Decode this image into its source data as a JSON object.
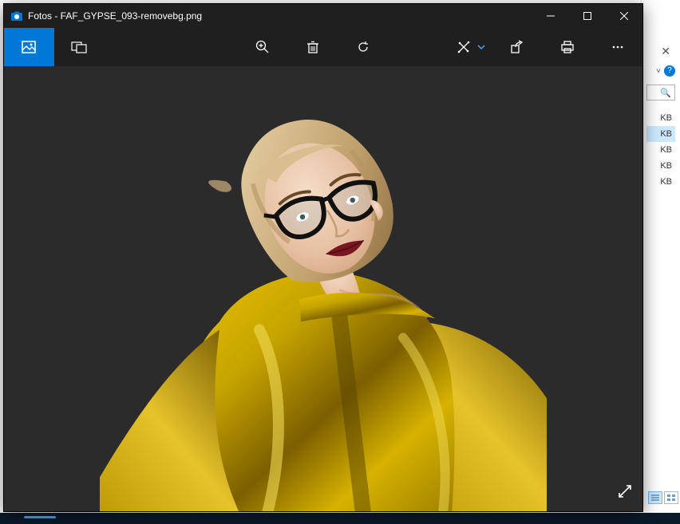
{
  "app": {
    "name": "Fotos",
    "file": "FAF_GYPSE_093-removebg.png"
  },
  "title": "Fotos - FAF_GYPSE_093-removebg.png",
  "window_controls": {
    "minimize": "—",
    "maximize": "▢",
    "close": "✕"
  },
  "toolbar": [
    {
      "id": "view-image",
      "icon": "photo-icon",
      "active": true
    },
    {
      "id": "compare",
      "icon": "compare-icon",
      "active": false
    },
    {
      "id": "spacer"
    },
    {
      "id": "zoom",
      "icon": "zoom-icon"
    },
    {
      "id": "delete",
      "icon": "trash-icon"
    },
    {
      "id": "rotate",
      "icon": "rotate-icon"
    },
    {
      "id": "spacer-short"
    },
    {
      "id": "edit",
      "icon": "edit-icon",
      "has_chevron": true
    },
    {
      "id": "share",
      "icon": "share-icon"
    },
    {
      "id": "print",
      "icon": "print-icon"
    },
    {
      "id": "more",
      "icon": "more-icon"
    }
  ],
  "fullscreen_label": "Full screen",
  "colors": {
    "accent": "#0078d7",
    "window_bg": "#1f1f1f",
    "canvas_bg": "#2b2b2b",
    "garment": "#c6a400",
    "garment_dark": "#8a6f00",
    "lip": "#7a1620",
    "skin": "#eccbb0",
    "hair": "#caa97a"
  },
  "explorer": {
    "close": "✕",
    "chevron": "˅",
    "help": "?",
    "search": "🔍",
    "size_suffix": "KB",
    "items": [
      {
        "label": "KB",
        "selected": false
      },
      {
        "label": "KB",
        "selected": true
      },
      {
        "label": "KB",
        "selected": false
      },
      {
        "label": "KB",
        "selected": false
      },
      {
        "label": "KB",
        "selected": false
      }
    ]
  }
}
